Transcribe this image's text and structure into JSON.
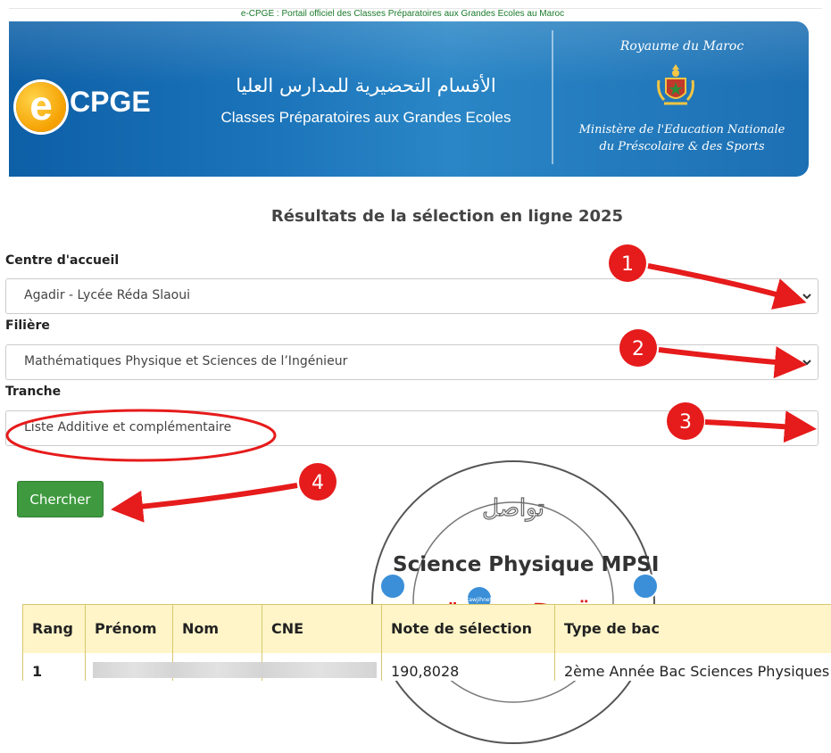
{
  "header": {
    "portal_caption": "e-CPGE : Portail officiel des Classes Préparatoires aux Grandes Ecoles au Maroc",
    "logo_letter": "e",
    "logo_text": "CPGE",
    "arabic_title": "الأقسام التحضيرية للمدارس العليا",
    "french_title": "Classes Préparatoires aux Grandes Ecoles",
    "kingdom": "Royaume du Maroc",
    "ministry_line1": "Ministère de l'Education Nationale",
    "ministry_line2": "du Préscolaire & des Sports"
  },
  "page": {
    "title": "Résultats de la sélection en ligne 2025"
  },
  "form": {
    "centre": {
      "label": "Centre d'accueil",
      "value": "Agadir - Lycée Réda Slaoui"
    },
    "filiere": {
      "label": "Filière",
      "value": "Mathématiques Physique et Sciences de l’Ingénieur"
    },
    "tranche": {
      "label": "Tranche",
      "value": "Liste Additive et complémentaire"
    },
    "search_button": "Chercher"
  },
  "annotations": {
    "markers": [
      "1",
      "2",
      "3",
      "4"
    ],
    "marker_color": "#e61b1b"
  },
  "watermark": {
    "text": "تواصل",
    "brand": "توجيه نت",
    "badge": "tawjihnet"
  },
  "results": {
    "heading": "Science Physique MPSI",
    "columns": [
      "Rang",
      "Prénom",
      "Nom",
      "CNE",
      "Note de sélection",
      "Type de bac"
    ],
    "rows": [
      {
        "rang": "1",
        "note": "190,8028",
        "type_bac": "2ème Année Bac Sciences Physiques"
      }
    ]
  },
  "colors": {
    "banner_blue": "#1a72b8",
    "button_green": "#3f9a3f",
    "table_header_bg": "#fff5c8",
    "table_border": "#d8c76e",
    "caption_green": "#1a7a2a"
  }
}
